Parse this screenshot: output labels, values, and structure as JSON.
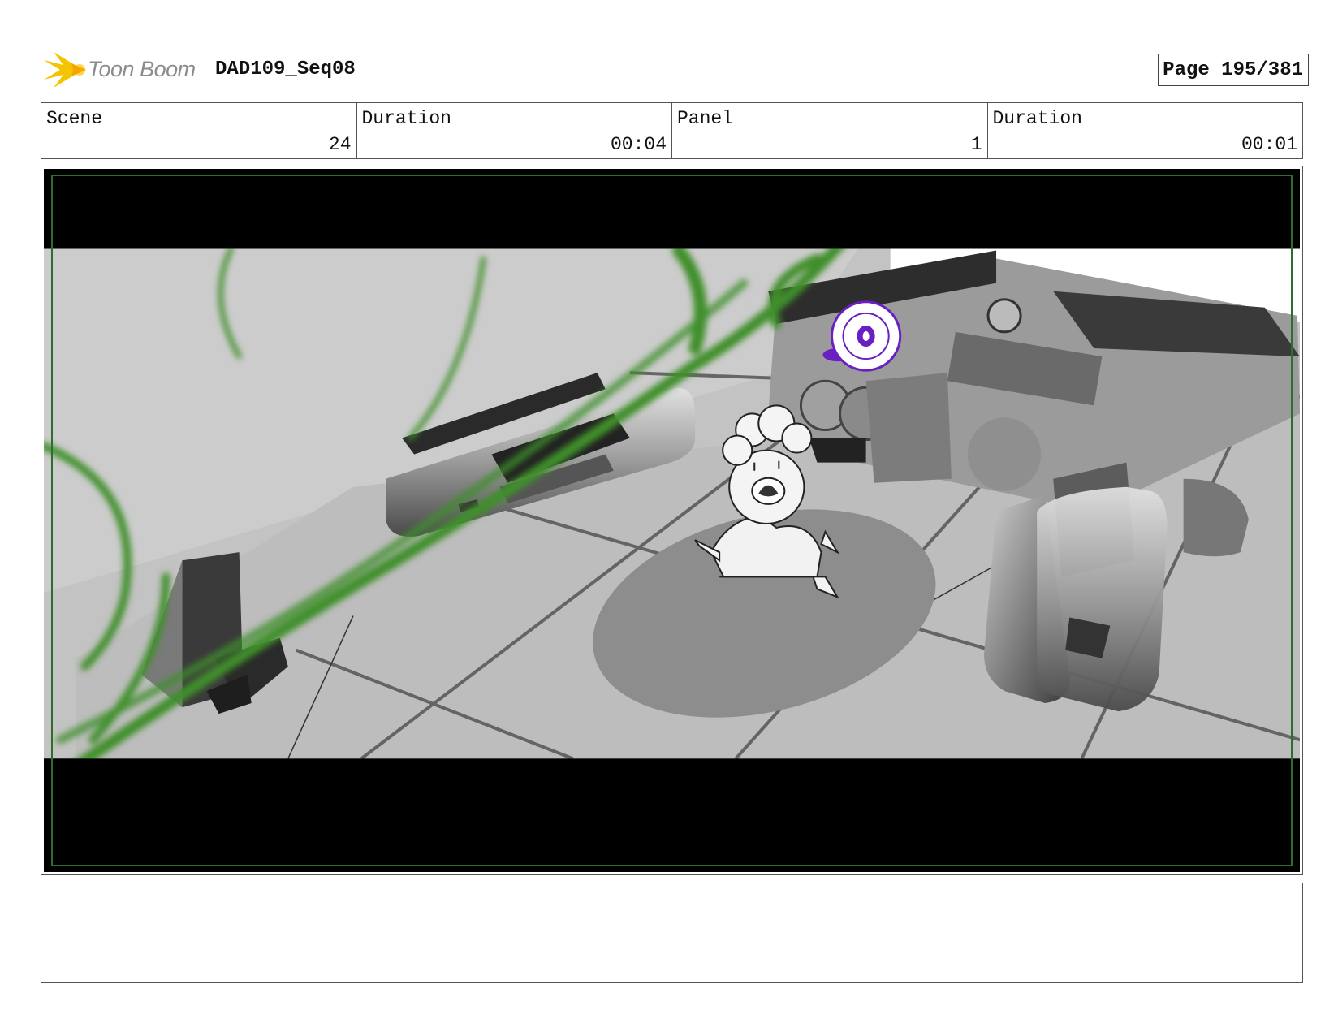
{
  "header": {
    "brand": "Toon Boom",
    "project_title": "DAD109_Seq08",
    "page_label": "Page 195/381"
  },
  "info": {
    "scene_label": "Scene",
    "scene_value": "24",
    "scene_duration_label": "Duration",
    "scene_duration_value": "00:04",
    "panel_label": "Panel",
    "panel_value": "1",
    "panel_duration_label": "Duration",
    "panel_duration_value": "00:01"
  },
  "notes": {
    "text": ""
  },
  "colors": {
    "logo_accent": "#f5c400",
    "logo_text": "#8c8c8c",
    "safe_frame": "#2d6e2a",
    "vine_green": "#3f8f2a",
    "purple_marker": "#6a1fc2"
  }
}
